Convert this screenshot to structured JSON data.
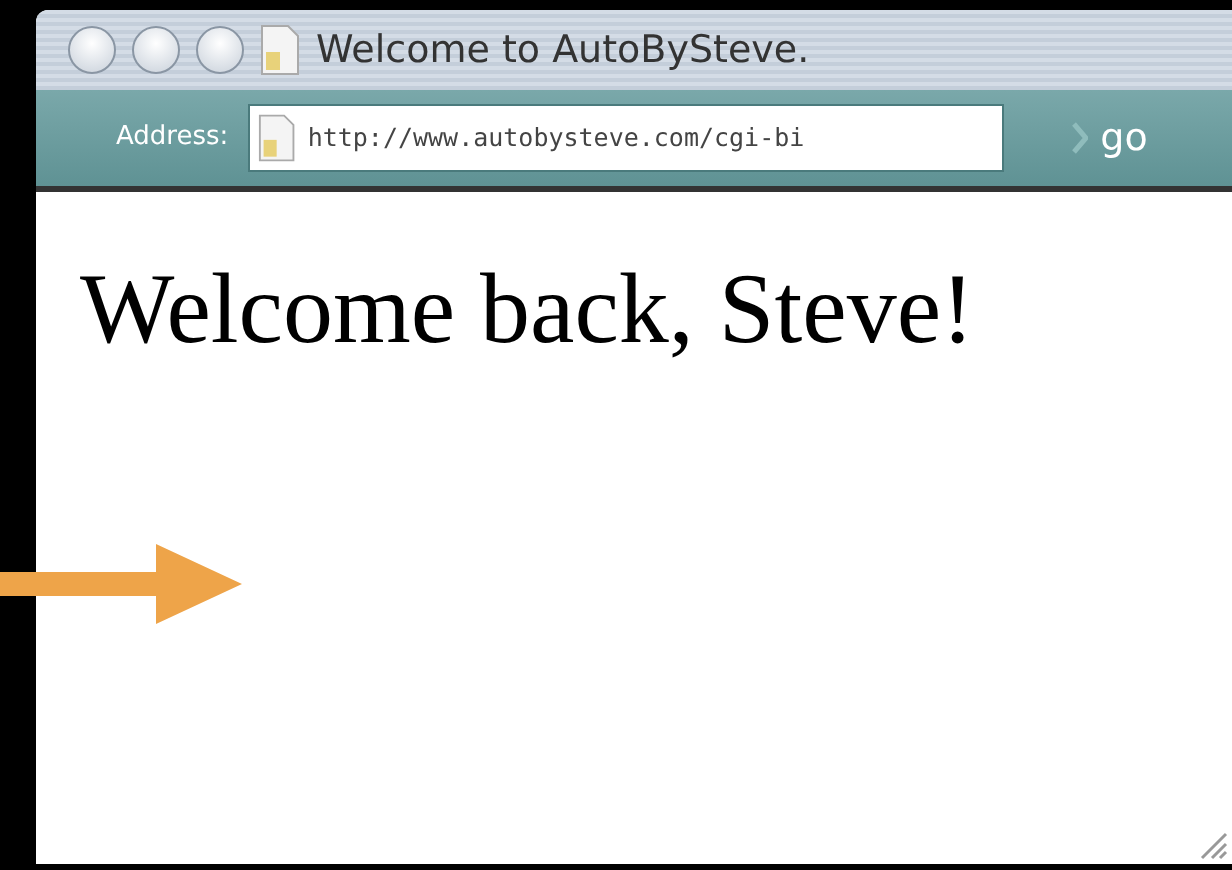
{
  "window": {
    "title": "Welcome to AutoBySteve."
  },
  "address_bar": {
    "label": "Address:",
    "value": "http://www.autobysteve.com/cgi-bi",
    "go": "go"
  },
  "page": {
    "heading": "Welcome back, Steve!"
  }
}
